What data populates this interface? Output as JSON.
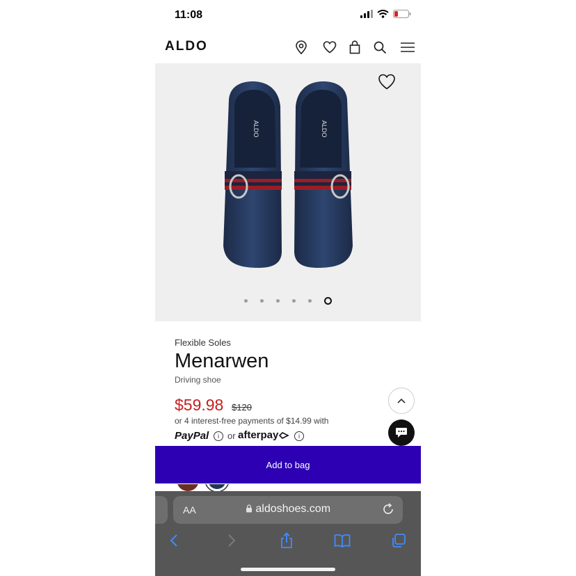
{
  "status": {
    "time": "11:08"
  },
  "header": {
    "logo": "ALDO"
  },
  "product": {
    "collection": "Flexible Soles",
    "name": "Menarwen",
    "type": "Driving shoe",
    "price": "$59.98",
    "original_price": "$120",
    "installments": "or 4 interest-free payments of $14.99 with",
    "paypal_label": "PayPal",
    "or_label": "or",
    "afterpay_label": "afterpay",
    "shoe_brand_print": "ALDO"
  },
  "carousel": {
    "total": 6,
    "active_index": 5
  },
  "actions": {
    "add_to_bag": "Add to bag"
  },
  "browser": {
    "aa_label": "AA",
    "url": "aldoshoes.com"
  },
  "colors": {
    "accent": "#2d00b3",
    "price": "#c4201f",
    "shoe": "#233657"
  }
}
